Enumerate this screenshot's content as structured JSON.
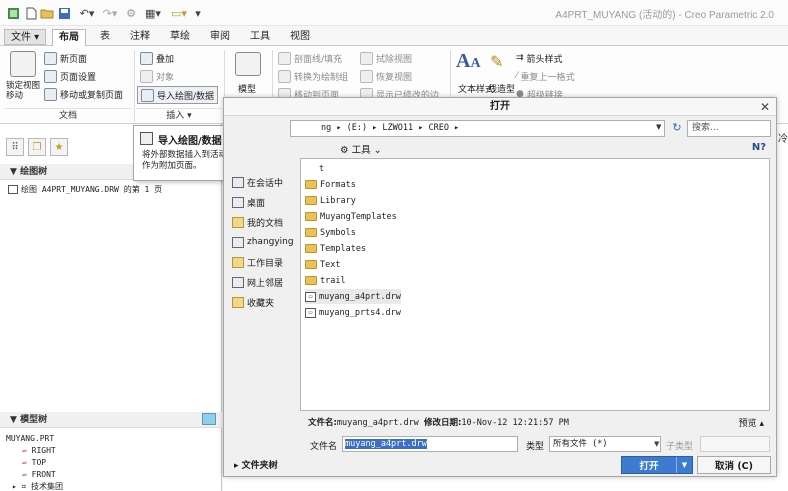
{
  "window": {
    "title": "A4PRT_MUYANG (活动的) - Creo Parametric 2.0"
  },
  "quick_access": [
    "app-icon",
    "new-icon",
    "open-icon",
    "save-icon",
    "undo-icon",
    "redo-icon",
    "regenerate-icon",
    "windows-icon",
    "close-window-icon",
    "customize-icon"
  ],
  "menu": {
    "file": "文件",
    "tabs": [
      "布局",
      "表",
      "注释",
      "草绘",
      "审阅",
      "工具",
      "视图"
    ],
    "active": "布局"
  },
  "ribbon": {
    "doc_group": {
      "lock_view": "锁定视图移动",
      "new_page": "新页面",
      "page_setup": "页面设置",
      "move_copy": "移动或复制页面",
      "label": "文档"
    },
    "insert_group": {
      "overlay": "叠加",
      "object": "对象",
      "import": "导入绘图/数据",
      "label": "插入"
    },
    "model_group": {
      "model_view": "模型"
    },
    "edit_group": {
      "section": "剖面线/填充",
      "convert": "转换为绘制组",
      "move_to_page": "移动到页面",
      "erase_view": "拭除视图",
      "restore_view": "恢复视图",
      "show_modify": "显示已修改的边"
    },
    "format_group": {
      "text_style": "文本样式",
      "line_style": "线造型",
      "arrow_style": "箭头样式",
      "repeat_format": "重复上一格式",
      "hyperlink": "超级链接"
    }
  },
  "tooltip": {
    "title": "导入绘图/数据",
    "desc": "将外部数据插入到活动页面中，或添加另一绘图作为附加页面。"
  },
  "left_panel": {
    "drawing_tree_hdr": "绘图树",
    "drawing_tree_item": "绘图 A4PRT_MUYANG.DRW 的第 1 页",
    "model_tree_hdr": "模型树",
    "model_tree": [
      "MUYANG.PRT",
      "RIGHT",
      "TOP",
      "FRONT",
      "技术集团"
    ]
  },
  "dialog": {
    "title": "打开",
    "path": "ng ▸ (E:) ▸ LZWO11 ▸ CREO ▸",
    "search_placeholder": "搜索...",
    "tools": "工具",
    "places": [
      "在会话中",
      "桌面",
      "我的文档",
      "zhangying",
      "工作目录",
      "网上邻居",
      "收藏夹"
    ],
    "files": [
      {
        "name": "Formats",
        "type": "folder"
      },
      {
        "name": "Library",
        "type": "folder"
      },
      {
        "name": "MuyangTemplates",
        "type": "folder"
      },
      {
        "name": "Symbols",
        "type": "folder"
      },
      {
        "name": "Templates",
        "type": "folder"
      },
      {
        "name": "Text",
        "type": "folder"
      },
      {
        "name": "trail",
        "type": "folder"
      },
      {
        "name": "muyang_a4prt.drw",
        "type": "drw"
      },
      {
        "name": "muyang_prts4.drw",
        "type": "drw"
      }
    ],
    "first_row_partial": "t",
    "file_info_label": "文件名",
    "file_info_name": "muyang_a4prt.drw",
    "mod_date_label": "修改日期",
    "mod_date": "10-Nov-12 12:21:57 PM",
    "preview": "预览",
    "filename_label": "文件名",
    "filename_value": "muyang_a4prt.drw",
    "type_label": "类型",
    "type_value": "所有文件 (*)",
    "subtype_label": "子类型",
    "folder_tree": "文件夹树",
    "open": "打开",
    "cancel": "取消 (C)"
  }
}
